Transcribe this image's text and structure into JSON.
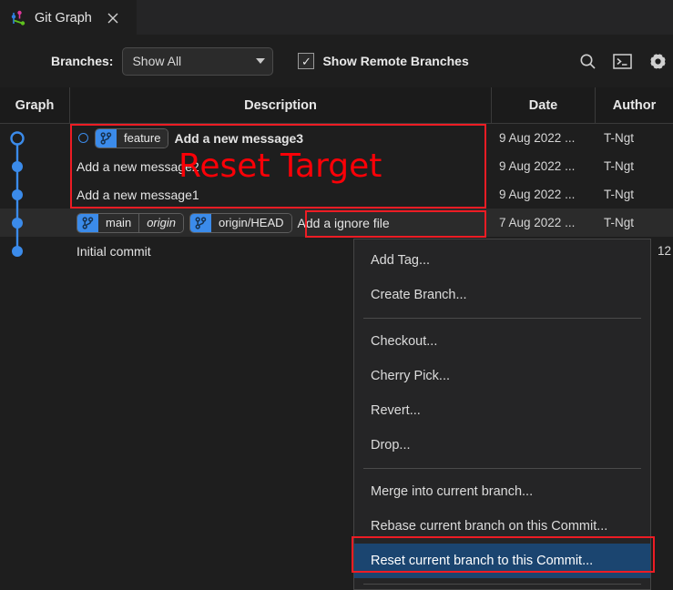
{
  "window": {
    "tab": {
      "title": "Git Graph",
      "icon": "git-graph-icon",
      "close_icon": "close-icon"
    }
  },
  "toolbar": {
    "branches_label": "Branches:",
    "branches_value": "Show All",
    "show_remote_label": "Show Remote Branches",
    "show_remote_checked": true,
    "check_glyph": "✓",
    "icons": [
      "search-icon",
      "terminal-icon",
      "gear-icon"
    ]
  },
  "table": {
    "columns": [
      "Graph",
      "Description",
      "Date",
      "Author"
    ],
    "rows": [
      {
        "refs": [],
        "head_marker": true,
        "message": "Add a new message3",
        "bold": true,
        "date": "9 Aug 2022 ...",
        "author": "T-Ngt",
        "selected": false,
        "chips": [
          {
            "icon": "branch-icon",
            "segments": [
              {
                "text": "feature",
                "italic": false
              }
            ]
          }
        ]
      },
      {
        "refs": [],
        "head_marker": false,
        "message": "Add a new message2",
        "bold": false,
        "date": "9 Aug 2022 ...",
        "author": "T-Ngt",
        "selected": false,
        "chips": []
      },
      {
        "refs": [],
        "head_marker": false,
        "message": "Add a new message1",
        "bold": false,
        "date": "9 Aug 2022 ...",
        "author": "T-Ngt",
        "selected": false,
        "chips": []
      },
      {
        "refs": [],
        "head_marker": false,
        "message": "Add a ignore file",
        "bold": false,
        "date": "7 Aug 2022 ...",
        "author": "T-Ngt",
        "selected": true,
        "chips": [
          {
            "icon": "branch-icon",
            "segments": [
              {
                "text": "main",
                "italic": false
              },
              {
                "text": "origin",
                "italic": true
              }
            ]
          },
          {
            "icon": "branch-icon",
            "segments": [
              {
                "text": "origin/HEAD",
                "italic": false
              }
            ]
          }
        ]
      },
      {
        "refs": [],
        "head_marker": false,
        "message": "Initial commit",
        "bold": false,
        "date": "",
        "author": "",
        "selected": false,
        "chips": []
      }
    ],
    "partial_right_text": "12"
  },
  "context_menu": {
    "items": [
      {
        "label": "Add Tag...",
        "type": "item",
        "active": false
      },
      {
        "label": "Create Branch...",
        "type": "item",
        "active": false
      },
      {
        "label": "",
        "type": "separator",
        "active": false
      },
      {
        "label": "Checkout...",
        "type": "item",
        "active": false
      },
      {
        "label": "Cherry Pick...",
        "type": "item",
        "active": false
      },
      {
        "label": "Revert...",
        "type": "item",
        "active": false
      },
      {
        "label": "Drop...",
        "type": "item",
        "active": false
      },
      {
        "label": "",
        "type": "separator",
        "active": false
      },
      {
        "label": "Merge into current branch...",
        "type": "item",
        "active": false
      },
      {
        "label": "Rebase current branch on this Commit...",
        "type": "item",
        "active": false
      },
      {
        "label": "Reset current branch to this Commit...",
        "type": "item",
        "active": true
      },
      {
        "label": "",
        "type": "separator",
        "active": false
      }
    ]
  },
  "annotations": {
    "reset_target_text": "Reset Target"
  },
  "colors": {
    "accent_blue": "#3b8bea",
    "annotation_red": "#ed1c24",
    "menu_highlight": "#1b4570",
    "background": "#1e1e1e"
  }
}
